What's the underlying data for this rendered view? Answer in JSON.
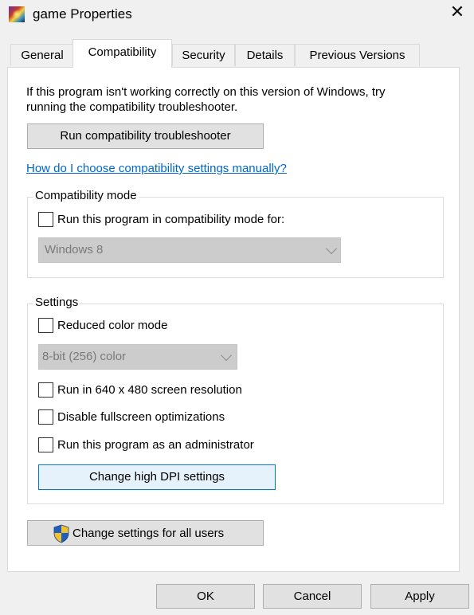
{
  "window": {
    "title": "game Properties",
    "app_icon": "game-icon",
    "close_glyph": "✕"
  },
  "tabs": [
    {
      "label": "General",
      "active": false
    },
    {
      "label": "Compatibility",
      "active": true
    },
    {
      "label": "Security",
      "active": false
    },
    {
      "label": "Details",
      "active": false
    },
    {
      "label": "Previous Versions",
      "active": false
    }
  ],
  "compatibility": {
    "intro_line1": "If this program isn't working correctly on this version of Windows, try",
    "intro_line2": "running the compatibility troubleshooter.",
    "troubleshooter_button": "Run compatibility troubleshooter",
    "help_link": "How do I choose compatibility settings manually?",
    "mode_group": {
      "label": "Compatibility mode",
      "checkbox_label": "Run this program in compatibility mode for:",
      "checked": false,
      "os_selected": "Windows 8"
    },
    "settings_group": {
      "label": "Settings",
      "reduced_color_label": "Reduced color mode",
      "reduced_color_checked": false,
      "color_depth_selected": "8-bit (256) color",
      "resolution_label": "Run in 640 x 480 screen resolution",
      "resolution_checked": false,
      "fullscreen_label": "Disable fullscreen optimizations",
      "fullscreen_checked": false,
      "admin_label": "Run this program as an administrator",
      "admin_checked": false,
      "dpi_button": "Change high DPI settings"
    },
    "all_users_button": "Change settings for all users",
    "all_users_icon": "uac-shield-icon"
  },
  "footer": {
    "ok": "OK",
    "cancel": "Cancel",
    "apply": "Apply"
  },
  "colors": {
    "link": "#0066cc",
    "focus_border": "#0078d7",
    "window_bg": "#f0f0f0",
    "panel_bg": "#ffffff"
  }
}
